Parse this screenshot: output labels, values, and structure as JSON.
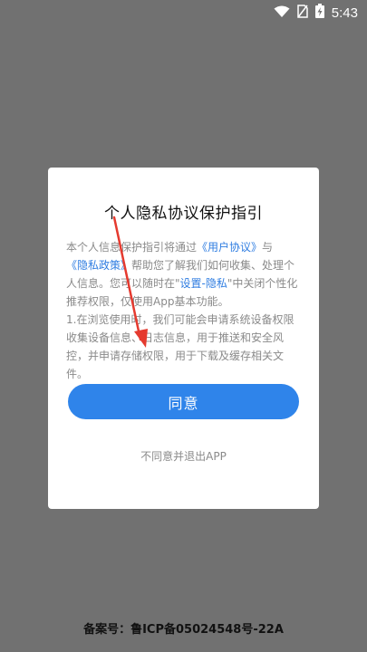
{
  "status_bar": {
    "time": "5:43"
  },
  "dialog": {
    "title": "个人隐私协议保护指引",
    "body_parts": [
      "本个人信息保护指引将通过",
      "《用户协议》",
      "与",
      "《隐私政策》",
      "帮助您了解我们如何收集、处理个人信息。您可以随时在\"",
      "设置-隐私",
      "\"中关闭个性化推荐权限，仅使用App基本功能。",
      "1.在浏览使用时，我们可能会申请系统设备权限收集设备信息、日志信息，用于推送和安全风控，并申请存储权限，用于下载及缓存相关文件。"
    ],
    "agree_label": "同意",
    "disagree_label": "不同意并退出APP"
  },
  "footer": {
    "icp": "备案号：鲁ICP备05024548号-22A"
  },
  "colors": {
    "accent": "#2f84ea",
    "link": "#2f7de1",
    "overlay": "#717171",
    "arrow": "#e53a2f"
  }
}
